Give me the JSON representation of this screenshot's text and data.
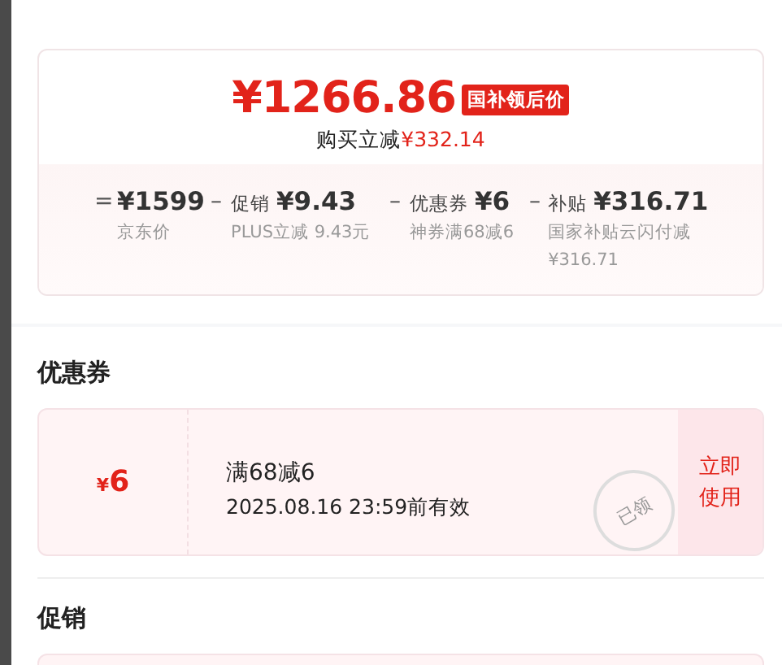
{
  "price": {
    "amount": "¥1266.86",
    "tag": "国补领后价",
    "saving_label": "购买立减",
    "saving_value": "¥332.14"
  },
  "breakdown": [
    {
      "op": "=",
      "value": "¥1599",
      "note": "京东价"
    },
    {
      "op": "–",
      "label": "促销",
      "value": "¥9.43",
      "note": "PLUS立减 9.43元"
    },
    {
      "op": "–",
      "label": "优惠券",
      "value": "¥6",
      "note": "神券满68减6"
    },
    {
      "op": "–",
      "label": "补贴",
      "value": "¥316.71",
      "note": "国家补贴云闪付减¥316.71"
    }
  ],
  "coupon_section": {
    "title": "优惠券",
    "coupons": [
      {
        "amount_symbol": "¥",
        "amount": "6",
        "condition": "满68减6",
        "validity": "2025.08.16 23:59前有效",
        "stamp": "已领",
        "action": "立即使用"
      }
    ]
  },
  "promo_section": {
    "title": "促销"
  }
}
